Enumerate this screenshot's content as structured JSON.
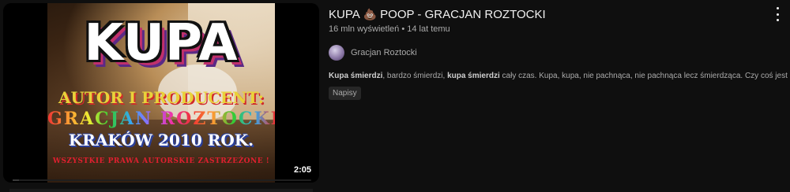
{
  "video": {
    "title_before": "KUPA",
    "title_emoji": "💩",
    "title_after": "POOP - GRACJAN ROZTOCKI",
    "views": "16 mln wyświetleń",
    "separator": "•",
    "age": "14 lat temu",
    "channel": "Gracjan Roztocki",
    "snippet": {
      "b1": "Kupa śmierdzi",
      "t1": ", bardzo śmierdzi, ",
      "b2": "kupa śmierdzi",
      "t2": " cały czas. Kupa, kupa, nie pachnąca, nie pachnąca lecz śmierdząca. Czy coś jest ..."
    },
    "badge": "Napisy",
    "duration": "2:05",
    "progress": 0.02
  },
  "thumbnail": {
    "headline": "KUPA",
    "line1": "AUTOR I PRODUCENT:",
    "line2": "GRACJAN ROZTOCKI",
    "line3": "KRAKÓW 2010 ROK.",
    "line4": "WSZYSTKIE PRAWA AUTORSKIE ZASTRZEŻONE !"
  },
  "icons": {
    "menu": "more-vert-icon",
    "avatar": "channel-avatar"
  }
}
